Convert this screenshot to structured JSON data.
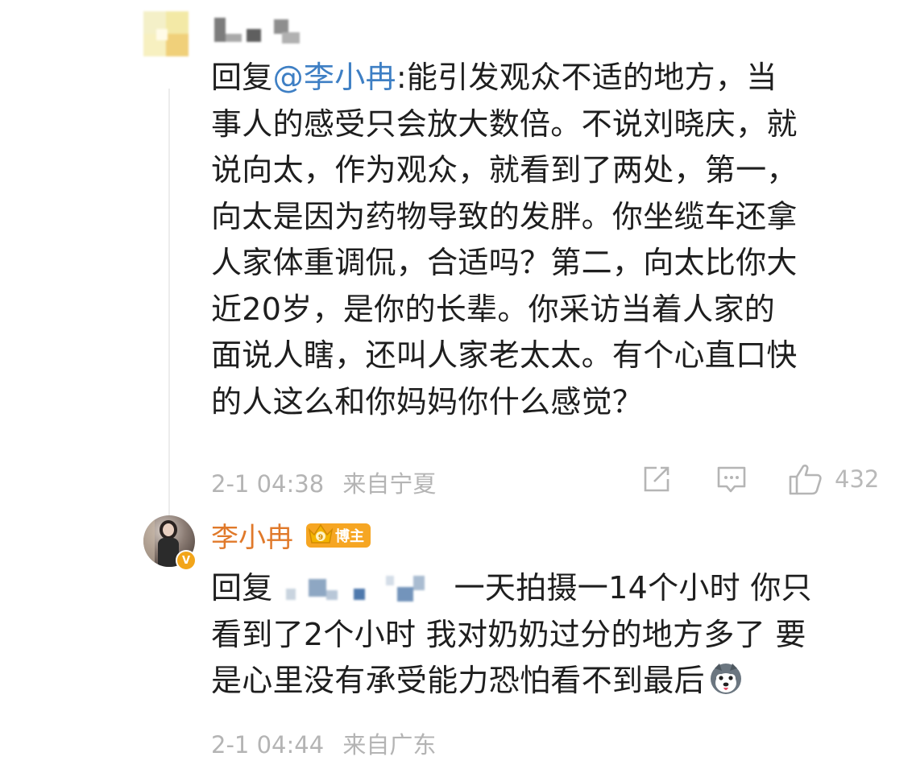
{
  "comment1": {
    "reply_prefix": "回复",
    "mention": "@李小冉",
    "text_after_mention": ":能引发观众不适的地方，当",
    "lines": [
      "事人的感受只会放大数倍。不说刘晓庆，就",
      "说向太，作为观众，就看到了两处，第一，",
      "向太是因为药物导致的发胖。你坐缆车还拿",
      "人家体重调侃，合适吗？第二，向太比你大",
      "近20岁，是你的长辈。你采访当着人家的",
      "面说人瞎，还叫人家老太太。有个心直口快",
      "的人这么和你妈妈你什么感觉？"
    ],
    "date": "2-1 04:38",
    "source": "来自宁夏",
    "like_count": "432"
  },
  "comment2": {
    "username": "李小冉",
    "badge": "博主",
    "reply_prefix": "回复",
    "line1": "一天拍摄一14个小时 你只",
    "lines": [
      "看到了2个小时 我对奶奶过分的地方多了 要",
      "是心里没有承受能力恐怕看不到最后"
    ],
    "date": "2-1 04:44",
    "source": "来自广东"
  },
  "icons": {
    "share": "share-icon",
    "comment": "comment-icon",
    "like": "thumbs-up-icon",
    "verified": "verified-v-icon",
    "crown": "crown-icon",
    "emoji": "husky-emoji-icon"
  },
  "colors": {
    "mention": "#3e7fc4",
    "username": "#e0792a",
    "meta": "#b4b4b4",
    "badge": "#f6a623"
  }
}
